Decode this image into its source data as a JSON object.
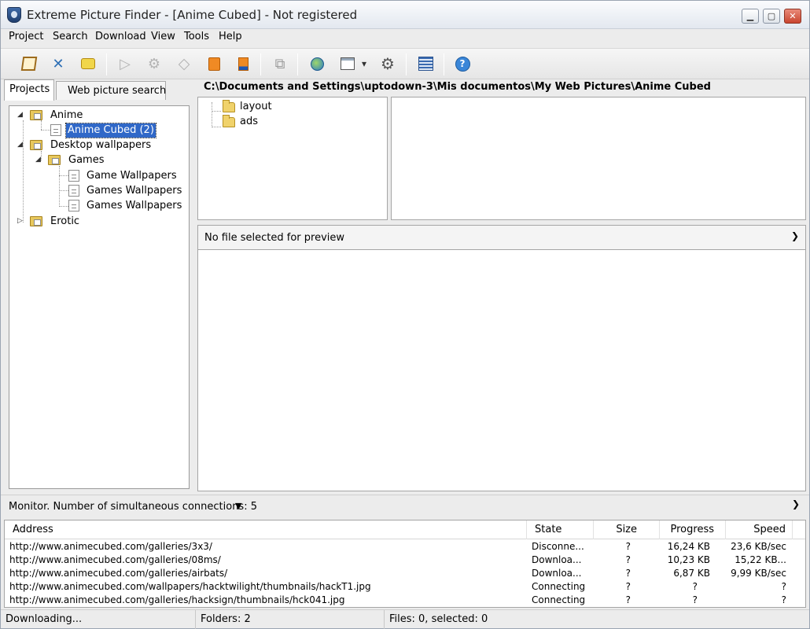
{
  "window": {
    "title": "Extreme Picture Finder - [Anime Cubed] - Not registered"
  },
  "menu": [
    "Project",
    "Search",
    "Download",
    "View",
    "Tools",
    "Help"
  ],
  "toolbar": {
    "icons": [
      "edit-icon",
      "tools-icon",
      "note-icon",
      "play-icon",
      "gear-grey-icon",
      "diamond-icon",
      "stop-icon",
      "stop-all-icon",
      "refresh-icon",
      "globe-icon",
      "window-icon",
      "gear-icon",
      "list-icon",
      "help-icon"
    ]
  },
  "tabs": {
    "projects": "Projects",
    "web_search": "Web picture search"
  },
  "tree": {
    "anime": "Anime",
    "anime_cubed": "Anime Cubed (2)",
    "desktop": "Desktop wallpapers",
    "games": "Games",
    "game_wallpapers": "Game Wallpapers",
    "games_wallpapers_1": "Games Wallpapers",
    "games_wallpapers_2": "Games Wallpapers",
    "erotic": "Erotic"
  },
  "path": "C:\\Documents and Settings\\uptodown-3\\Mis documentos\\My Web Pictures\\Anime Cubed",
  "folders": [
    "layout",
    "ads"
  ],
  "preview": {
    "text": "No file selected for preview"
  },
  "monitor": {
    "text": "Monitor. Number of simultaneous connections: 5"
  },
  "downloads": {
    "columns": [
      "Address",
      "State",
      "Size",
      "Progress",
      "Speed"
    ],
    "rows": [
      {
        "address": "http://www.animecubed.com/galleries/3x3/",
        "state": "Disconne...",
        "size": "?",
        "progress": "16,24 KB",
        "speed": "23,6 KB/sec"
      },
      {
        "address": "http://www.animecubed.com/galleries/08ms/",
        "state": "Downloa...",
        "size": "?",
        "progress": "10,23 KB",
        "speed": "15,22 KB..."
      },
      {
        "address": "http://www.animecubed.com/galleries/airbats/",
        "state": "Downloa...",
        "size": "?",
        "progress": "6,87 KB",
        "speed": "9,99 KB/sec"
      },
      {
        "address": "http://www.animecubed.com/wallpapers/hacktwilight/thumbnails/hackT1.jpg",
        "state": "Connecting",
        "size": "?",
        "progress": "?",
        "speed": "?"
      },
      {
        "address": "http://www.animecubed.com/galleries/hacksign/thumbnails/hck041.jpg",
        "state": "Connecting",
        "size": "?",
        "progress": "?",
        "speed": "?"
      }
    ]
  },
  "status": {
    "left": "Downloading...",
    "folders": "Folders: 2",
    "files": "Files: 0, selected: 0"
  }
}
